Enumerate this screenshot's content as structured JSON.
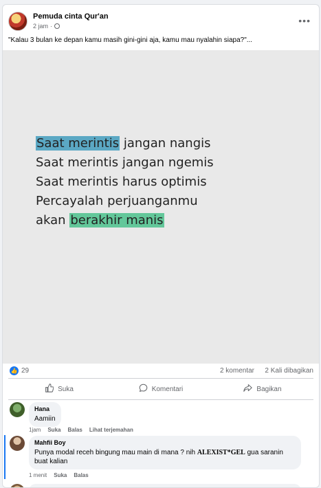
{
  "post": {
    "page_name": "Pemuda cinta Qur'an",
    "time": "2 jam",
    "separator": "·",
    "caption": "\"Kalau 3 bulan ke depan kamu masih gini-gini aja, kamu mau nyalahin siapa?\"...",
    "quote": {
      "line1_highlight": "Saat merintis",
      "line1_rest": " jangan nangis",
      "line2": "Saat merintis jangan ngemis",
      "line3": "Saat merintis harus optimis",
      "line4": "Percayalah perjuanganmu",
      "line5_start": "akan ",
      "line5_highlight": "berakhir manis"
    },
    "highlight_colors": {
      "blue": "#5ba8c4",
      "green": "#63c79a"
    }
  },
  "stats": {
    "likes": "29",
    "comments": "2 komentar",
    "shares": "2 Kali dibagikan"
  },
  "actions": {
    "like": "Suka",
    "comment": "Komentari",
    "share": "Bagikan"
  },
  "comments": [
    {
      "author": "Hana",
      "text": "Aamiin",
      "time": "1jam",
      "like": "Suka",
      "reply": "Balas",
      "translate": "Lihat terjemahan"
    },
    {
      "author": "Mahfii Boy",
      "text_before": "Punya modal receh bingung mau main di mana ? nih ",
      "text_bold": "ALEXIST*GEL",
      "text_after": " gua saranin buat kalian",
      "time": "1 menit",
      "like": "Suka",
      "reply": "Balas"
    }
  ],
  "icons": {
    "more": "more-options-icon",
    "globe": "globe-icon",
    "like_badge": "thumbs-up-badge-icon",
    "like": "thumbs-up-icon",
    "comment": "speech-bubble-icon",
    "share": "share-arrow-icon"
  },
  "colors": {
    "brand": "#1877f2",
    "text": "#050505",
    "muted": "#65676b"
  }
}
